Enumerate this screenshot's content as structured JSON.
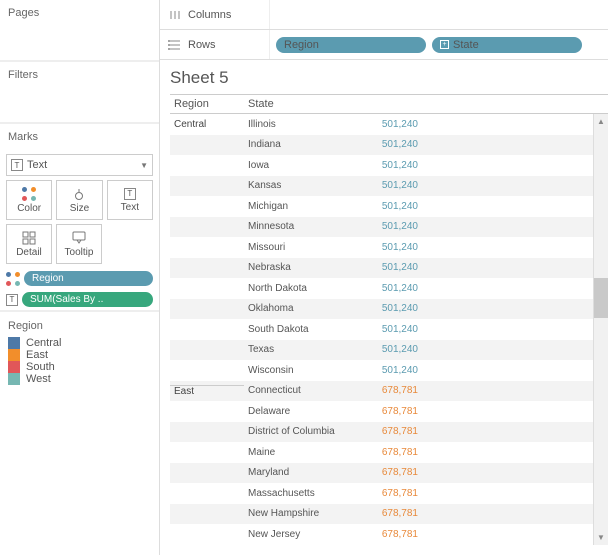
{
  "panels": {
    "pages": "Pages",
    "filters": "Filters",
    "marks": "Marks"
  },
  "marks": {
    "type": "Text",
    "buttons": {
      "color": "Color",
      "size": "Size",
      "text": "Text",
      "detail": "Detail",
      "tooltip": "Tooltip"
    },
    "pills": {
      "region": "Region",
      "sum": "SUM(Sales By .."
    }
  },
  "legend": {
    "title": "Region",
    "items": [
      {
        "label": "Central",
        "color": "#4e79a7"
      },
      {
        "label": "East",
        "color": "#f28e2b"
      },
      {
        "label": "South",
        "color": "#e15759"
      },
      {
        "label": "West",
        "color": "#76b7b2"
      }
    ]
  },
  "shelves": {
    "columns": "Columns",
    "rows": "Rows",
    "row_pills": [
      {
        "label": "Region"
      },
      {
        "label": "State",
        "expand": "+"
      }
    ]
  },
  "sheet": {
    "title": "Sheet 5",
    "headers": {
      "region": "Region",
      "state": "State"
    },
    "rows": [
      {
        "region": "Central",
        "state": "Illinois",
        "val": "501,240",
        "c": "#5b9bb0"
      },
      {
        "region": "",
        "state": "Indiana",
        "val": "501,240",
        "c": "#5b9bb0",
        "alt": true
      },
      {
        "region": "",
        "state": "Iowa",
        "val": "501,240",
        "c": "#5b9bb0"
      },
      {
        "region": "",
        "state": "Kansas",
        "val": "501,240",
        "c": "#5b9bb0",
        "alt": true
      },
      {
        "region": "",
        "state": "Michigan",
        "val": "501,240",
        "c": "#5b9bb0"
      },
      {
        "region": "",
        "state": "Minnesota",
        "val": "501,240",
        "c": "#5b9bb0",
        "alt": true
      },
      {
        "region": "",
        "state": "Missouri",
        "val": "501,240",
        "c": "#5b9bb0"
      },
      {
        "region": "",
        "state": "Nebraska",
        "val": "501,240",
        "c": "#5b9bb0",
        "alt": true
      },
      {
        "region": "",
        "state": "North Dakota",
        "val": "501,240",
        "c": "#5b9bb0"
      },
      {
        "region": "",
        "state": "Oklahoma",
        "val": "501,240",
        "c": "#5b9bb0",
        "alt": true
      },
      {
        "region": "",
        "state": "South Dakota",
        "val": "501,240",
        "c": "#5b9bb0"
      },
      {
        "region": "",
        "state": "Texas",
        "val": "501,240",
        "c": "#5b9bb0",
        "alt": true
      },
      {
        "region": "",
        "state": "Wisconsin",
        "val": "501,240",
        "c": "#5b9bb0"
      },
      {
        "region": "East",
        "state": "Connecticut",
        "val": "678,781",
        "c": "#e8893a",
        "alt": true,
        "brk": true
      },
      {
        "region": "",
        "state": "Delaware",
        "val": "678,781",
        "c": "#e8893a"
      },
      {
        "region": "",
        "state": "District of Columbia",
        "val": "678,781",
        "c": "#e8893a",
        "alt": true
      },
      {
        "region": "",
        "state": "Maine",
        "val": "678,781",
        "c": "#e8893a"
      },
      {
        "region": "",
        "state": "Maryland",
        "val": "678,781",
        "c": "#e8893a",
        "alt": true
      },
      {
        "region": "",
        "state": "Massachusetts",
        "val": "678,781",
        "c": "#e8893a"
      },
      {
        "region": "",
        "state": "New Hampshire",
        "val": "678,781",
        "c": "#e8893a",
        "alt": true
      },
      {
        "region": "",
        "state": "New Jersey",
        "val": "678,781",
        "c": "#e8893a"
      }
    ]
  }
}
